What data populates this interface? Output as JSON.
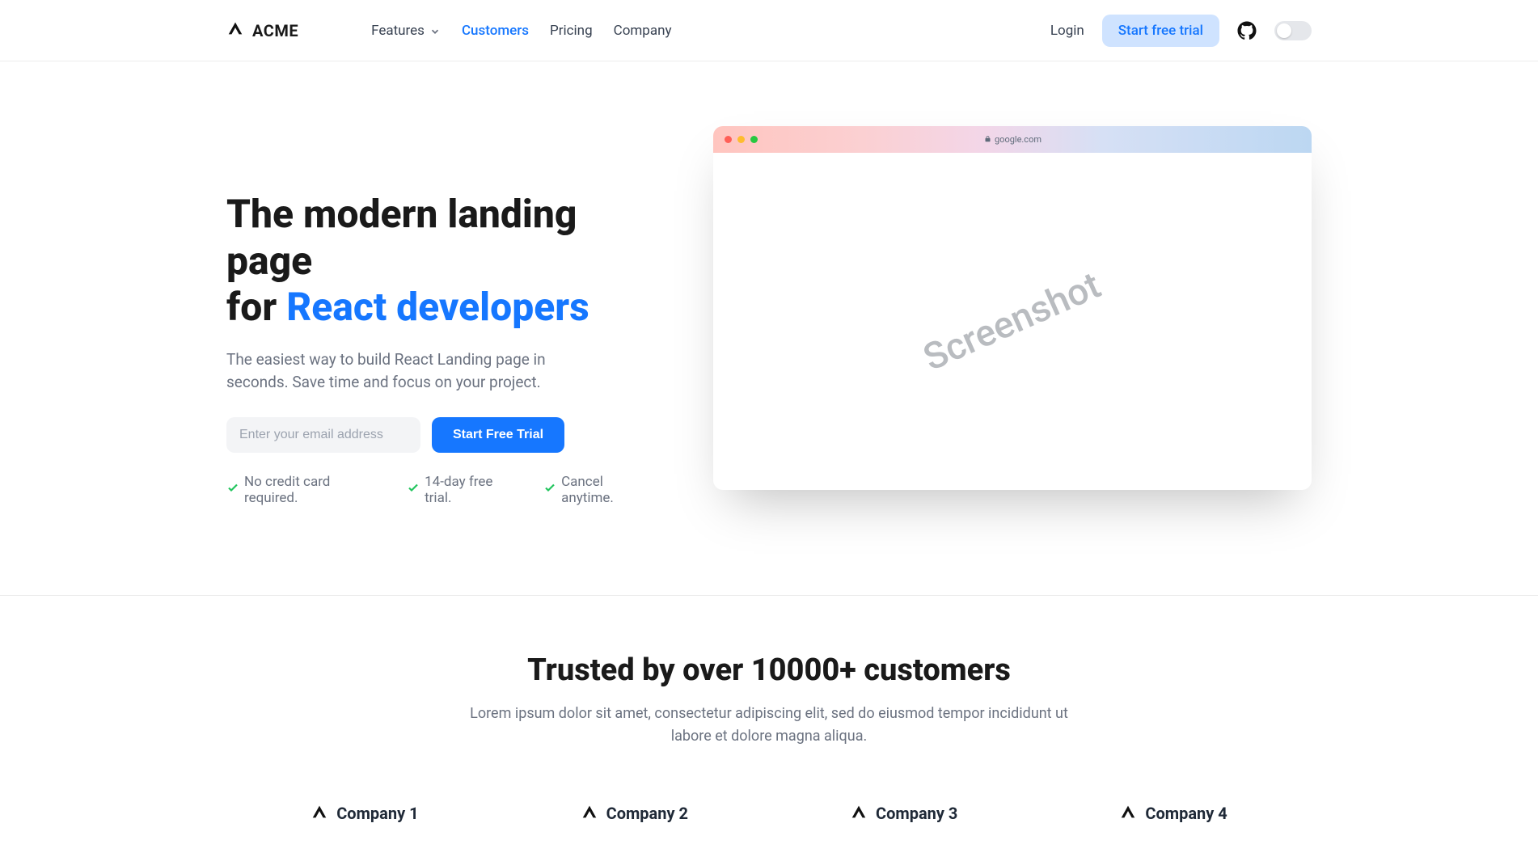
{
  "brand": {
    "name": "ACME"
  },
  "nav": {
    "items": [
      {
        "label": "Features",
        "has_chevron": true
      },
      {
        "label": "Customers",
        "active": true
      },
      {
        "label": "Pricing"
      },
      {
        "label": "Company"
      }
    ],
    "login": "Login",
    "cta": "Start free trial"
  },
  "hero": {
    "title_line1": "The modern landing page",
    "title_line2_pre": "for ",
    "title_line2_highlight": "React developers",
    "subtitle": "The easiest way to build React Landing page in seconds. Save time and focus on your project.",
    "email_placeholder": "Enter your email address",
    "cta": "Start Free Trial",
    "checks": [
      "No credit card required.",
      "14-day free trial.",
      "Cancel anytime."
    ],
    "browser_url": "google.com",
    "browser_placeholder": "Screenshot"
  },
  "trusted": {
    "title": "Trusted by over 10000+ customers",
    "subtitle": "Lorem ipsum dolor sit amet, consectetur adipiscing elit, sed do eiusmod tempor incididunt ut labore et dolore magna aliqua.",
    "companies": [
      "Company 1",
      "Company 2",
      "Company 3",
      "Company 4"
    ]
  }
}
